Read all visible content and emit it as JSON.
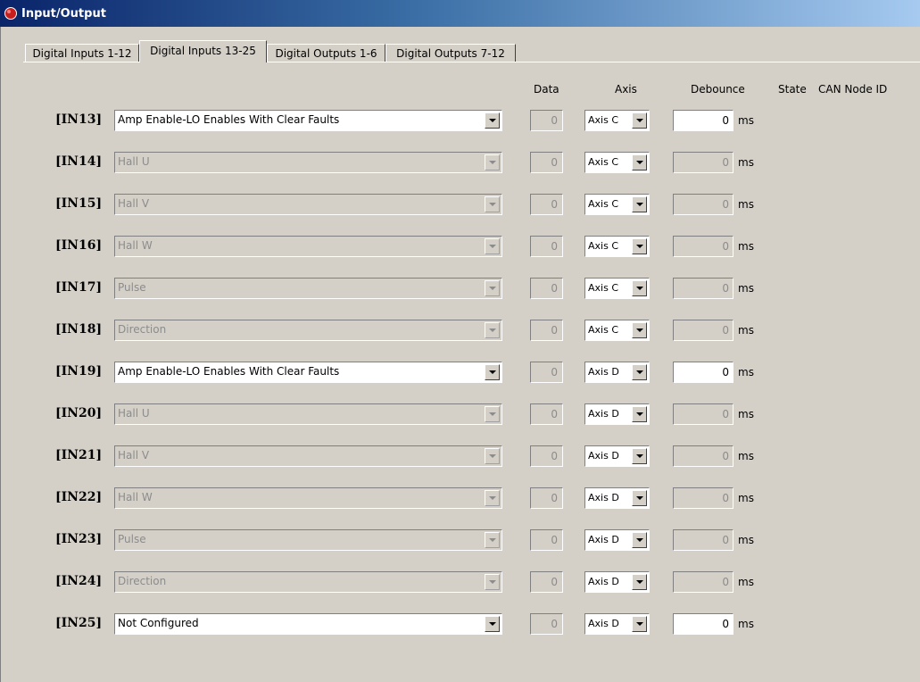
{
  "window": {
    "title": "Input/Output"
  },
  "tabs": [
    {
      "label": "Digital Inputs 1-12",
      "active": false
    },
    {
      "label": "Digital Inputs 13-25",
      "active": true
    },
    {
      "label": "Digital Outputs 1-6",
      "active": false
    },
    {
      "label": "Digital Outputs 7-12",
      "active": false
    }
  ],
  "columns": {
    "data": "Data",
    "axis": "Axis",
    "debounce": "Debounce",
    "state": "State",
    "can_node_id": "CAN Node ID"
  },
  "rows": [
    {
      "label": "[IN13]",
      "function": "Amp Enable-LO Enables With Clear Faults",
      "enabled": true,
      "data": "0",
      "axis": "Axis C",
      "debounce": "0",
      "unit": "ms"
    },
    {
      "label": "[IN14]",
      "function": "Hall U",
      "enabled": false,
      "data": "0",
      "axis": "Axis C",
      "debounce": "0",
      "unit": "ms"
    },
    {
      "label": "[IN15]",
      "function": "Hall V",
      "enabled": false,
      "data": "0",
      "axis": "Axis C",
      "debounce": "0",
      "unit": "ms"
    },
    {
      "label": "[IN16]",
      "function": "Hall W",
      "enabled": false,
      "data": "0",
      "axis": "Axis C",
      "debounce": "0",
      "unit": "ms"
    },
    {
      "label": "[IN17]",
      "function": "Pulse",
      "enabled": false,
      "data": "0",
      "axis": "Axis C",
      "debounce": "0",
      "unit": "ms"
    },
    {
      "label": "[IN18]",
      "function": "Direction",
      "enabled": false,
      "data": "0",
      "axis": "Axis C",
      "debounce": "0",
      "unit": "ms"
    },
    {
      "label": "[IN19]",
      "function": "Amp Enable-LO Enables With Clear Faults",
      "enabled": true,
      "data": "0",
      "axis": "Axis D",
      "debounce": "0",
      "unit": "ms"
    },
    {
      "label": "[IN20]",
      "function": "Hall U",
      "enabled": false,
      "data": "0",
      "axis": "Axis D",
      "debounce": "0",
      "unit": "ms"
    },
    {
      "label": "[IN21]",
      "function": "Hall V",
      "enabled": false,
      "data": "0",
      "axis": "Axis D",
      "debounce": "0",
      "unit": "ms"
    },
    {
      "label": "[IN22]",
      "function": "Hall W",
      "enabled": false,
      "data": "0",
      "axis": "Axis D",
      "debounce": "0",
      "unit": "ms"
    },
    {
      "label": "[IN23]",
      "function": "Pulse",
      "enabled": false,
      "data": "0",
      "axis": "Axis D",
      "debounce": "0",
      "unit": "ms"
    },
    {
      "label": "[IN24]",
      "function": "Direction",
      "enabled": false,
      "data": "0",
      "axis": "Axis D",
      "debounce": "0",
      "unit": "ms"
    },
    {
      "label": "[IN25]",
      "function": "Not Configured",
      "enabled": true,
      "data": "0",
      "axis": "Axis D",
      "debounce": "0",
      "unit": "ms"
    }
  ]
}
